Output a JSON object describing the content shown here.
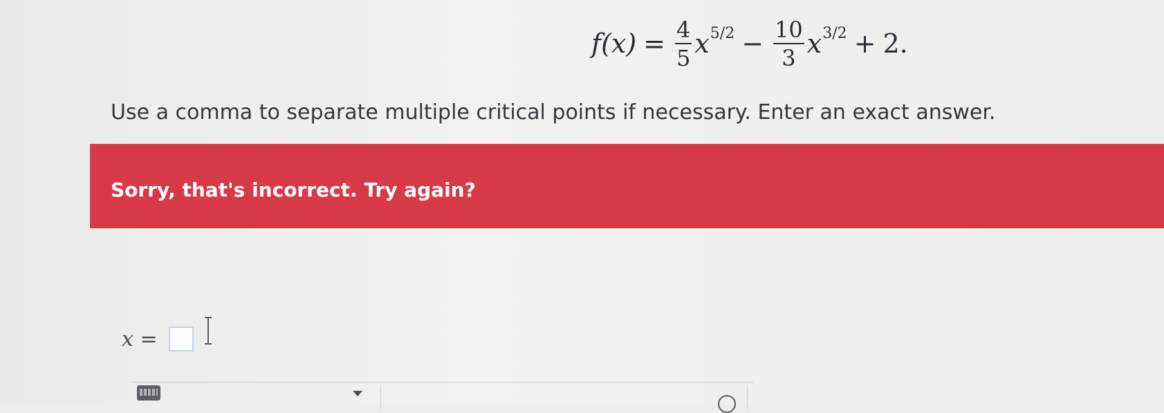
{
  "equation": {
    "lhs": "f(x)",
    "equals": "=",
    "term1_num": "4",
    "term1_den": "5",
    "term1_var": "x",
    "term1_exp": "5/2",
    "minus": "−",
    "term2_num": "10",
    "term2_den": "3",
    "term2_var": "x",
    "term2_exp": "3/2",
    "plus": "+",
    "constant": "2."
  },
  "instructions": "Use a comma to separate multiple critical points if necessary. Enter an exact answer.",
  "feedback": {
    "message": "Sorry, that's incorrect. Try again?",
    "color": "#d63a46"
  },
  "answer": {
    "label_var": "x",
    "label_eq": "=",
    "value": ""
  },
  "toolbar": {
    "keyboard_icon": "keyboard-icon",
    "dropdown_icon": "chevron-down-icon",
    "help_icon": "help-icon"
  }
}
